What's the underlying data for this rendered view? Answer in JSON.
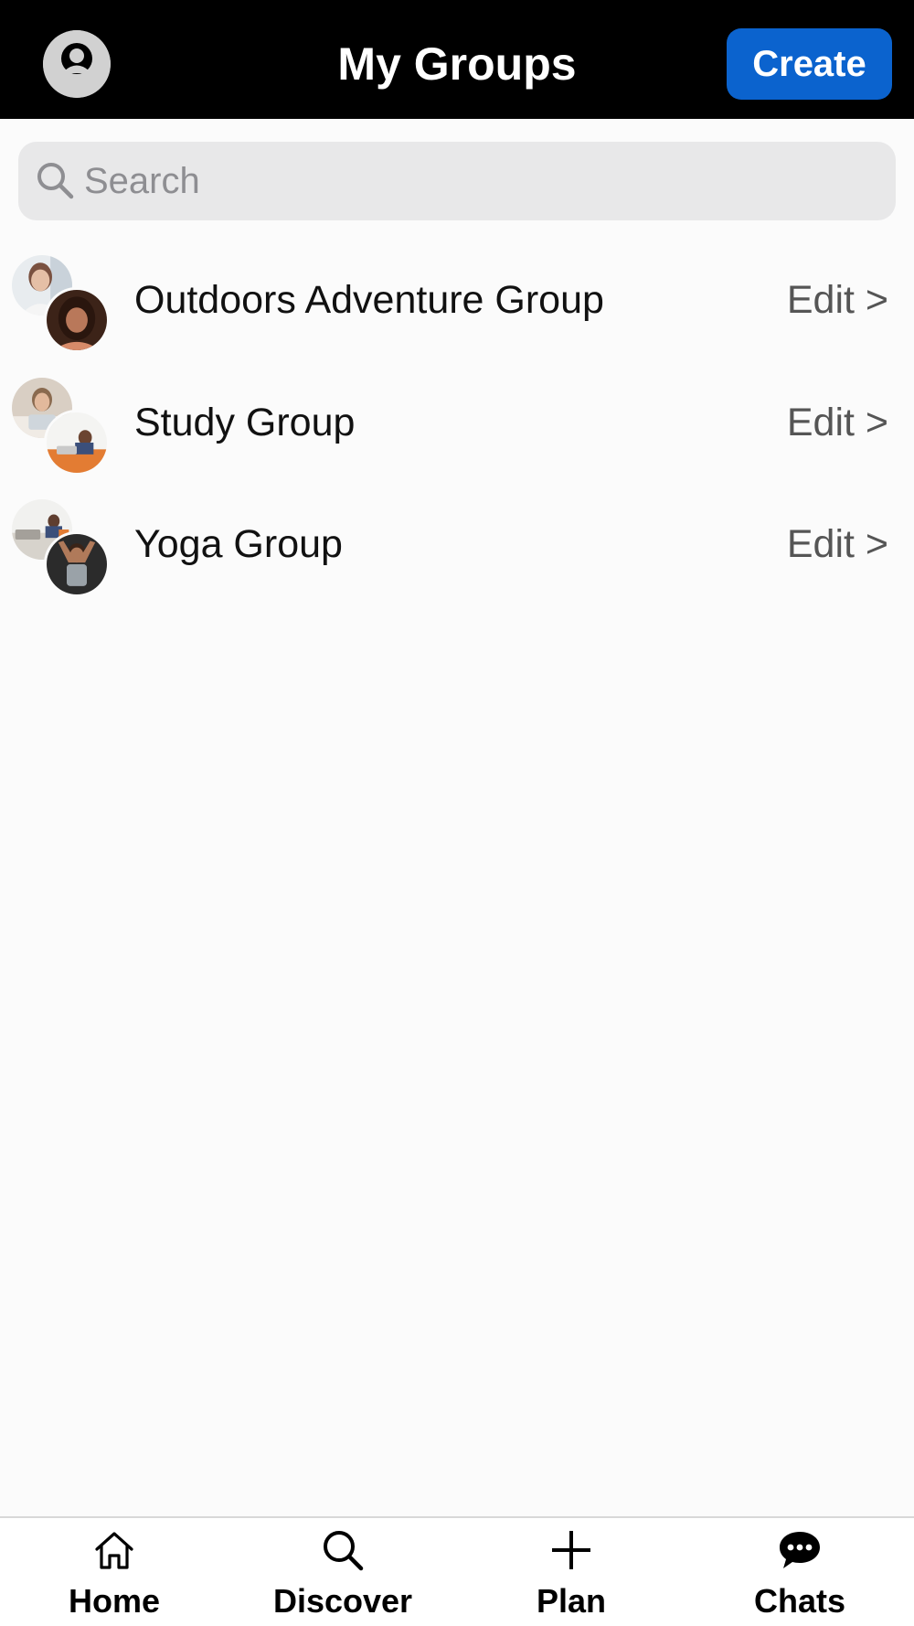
{
  "header": {
    "title": "My Groups",
    "create_label": "Create",
    "profile_icon": "person-icon",
    "background": "#000000",
    "accent": "#0b63ce"
  },
  "search": {
    "placeholder": "Search",
    "value": ""
  },
  "groups": [
    {
      "name": "Outdoors Adventure Group",
      "edit_label": "Edit >"
    },
    {
      "name": "Study Group",
      "edit_label": "Edit >"
    },
    {
      "name": "Yoga Group",
      "edit_label": "Edit >"
    }
  ],
  "nav": {
    "items": [
      {
        "label": "Home",
        "icon": "home-icon"
      },
      {
        "label": "Discover",
        "icon": "search-icon"
      },
      {
        "label": "Plan",
        "icon": "plus-icon"
      },
      {
        "label": "Chats",
        "icon": "chat-bubble-icon"
      }
    ]
  }
}
